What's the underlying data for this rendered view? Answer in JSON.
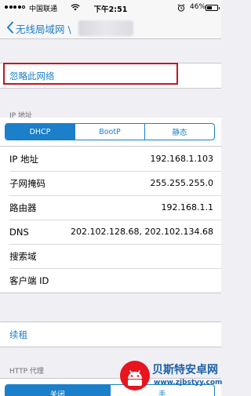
{
  "status_bar": {
    "carrier": "中国联通",
    "time": "下午2:51",
    "battery_percent": "46%",
    "battery_level": 0.46,
    "signal_bars_filled": 4
  },
  "nav": {
    "back_label": "无线局域网 \\"
  },
  "forget_network": {
    "label": "忽略此网络"
  },
  "ip_section": {
    "header": "IP 地址",
    "segments": [
      "DHCP",
      "BootP",
      "静态"
    ],
    "selected": "DHCP"
  },
  "details": [
    {
      "label": "IP 地址",
      "value": "192.168.1.103"
    },
    {
      "label": "子网掩码",
      "value": "255.255.255.0"
    },
    {
      "label": "路由器",
      "value": "192.168.1.1"
    },
    {
      "label": "DNS",
      "value": "202.102.128.68, 202.102.134.68"
    },
    {
      "label": "搜索域",
      "value": ""
    },
    {
      "label": "客户端 ID",
      "value": ""
    }
  ],
  "renew": {
    "label": "续租"
  },
  "http_proxy": {
    "header": "HTTP 代理",
    "segments": [
      "关闭",
      "手"
    ],
    "selected": "关闭"
  },
  "watermark": {
    "title": "贝斯特安卓网",
    "url": "www.zjbstyy.com"
  },
  "colors": {
    "accent": "#1b7fc9",
    "highlight_box": "#c8141e",
    "background": "#efeff4"
  }
}
